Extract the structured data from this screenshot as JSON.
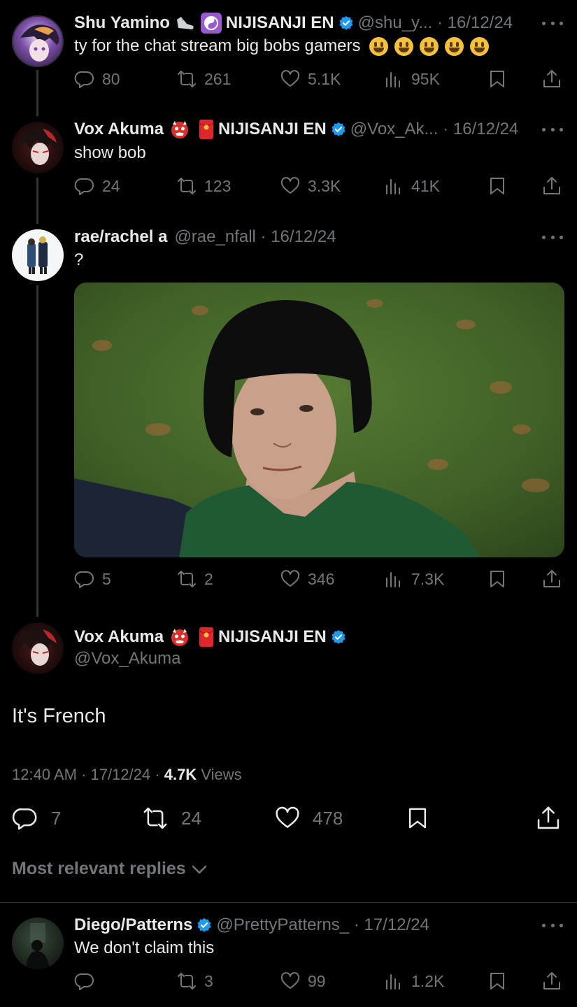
{
  "posts": [
    {
      "name": "Shu Yamino",
      "affiliation": "NIJISANJI EN",
      "handle": "@shu_y...",
      "date": "16/12/24",
      "text": "ty for the chat stream big bobs gamers",
      "emoji": [
        "grinning-face",
        "grinning-face",
        "grinning-face",
        "grinning-face",
        "grinning-face"
      ],
      "stats": {
        "replies": "80",
        "reposts": "261",
        "likes": "5.1K",
        "views": "95K"
      }
    },
    {
      "name": "Vox Akuma",
      "affiliation": "NIJISANJI EN",
      "handle": "@Vox_Ak...",
      "date": "16/12/24",
      "text": "show bob",
      "stats": {
        "replies": "24",
        "reposts": "123",
        "likes": "3.3K",
        "views": "41K"
      }
    },
    {
      "name": "rae/rachel a",
      "handle": "@rae_nfall",
      "date": "16/12/24",
      "text": "?",
      "media": "photo-woman-bob-haircut",
      "stats": {
        "replies": "5",
        "reposts": "2",
        "likes": "346",
        "views": "7.3K"
      }
    }
  ],
  "main_post": {
    "name": "Vox Akuma",
    "affiliation": "NIJISANJI EN",
    "handle": "@Vox_Akuma",
    "text": "It's French",
    "time": "12:40 AM",
    "date": "17/12/24",
    "views_count": "4.7K",
    "views_label": "Views",
    "stats": {
      "replies": "7",
      "reposts": "24",
      "likes": "478"
    }
  },
  "replies_filter": "Most relevant replies",
  "reply": {
    "name": "Diego/Patterns",
    "handle": "@PrettyPatterns_",
    "date": "17/12/24",
    "text": "We don't claim this",
    "stats": {
      "reposts": "3",
      "likes": "99",
      "views": "1.2K"
    }
  },
  "colors": {
    "background": "#000000",
    "text": "#e7e9ea",
    "muted": "#71767b",
    "verified": "#1d9bf0"
  }
}
